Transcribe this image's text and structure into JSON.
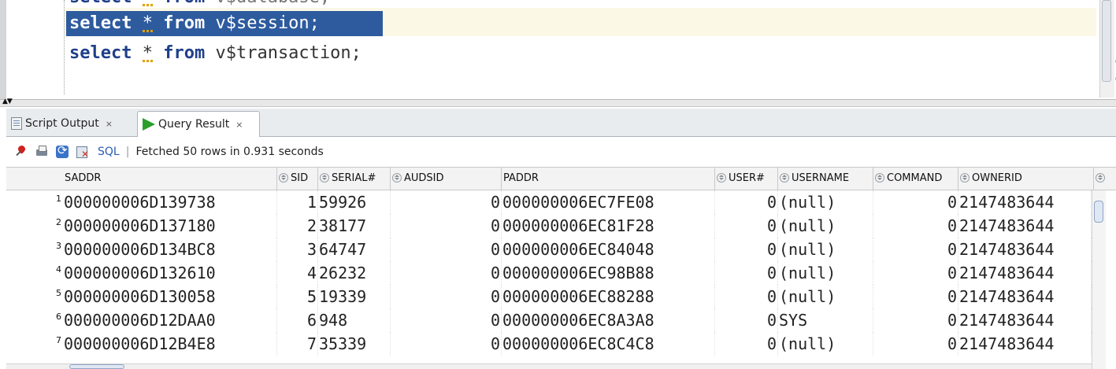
{
  "editor": {
    "lines": [
      {
        "kw1": "select",
        "star": "*",
        "kw2": "from",
        "obj": "v$database;"
      },
      {
        "kw1": "select",
        "star": "*",
        "kw2": "from",
        "obj": "v$session;"
      },
      {
        "kw1": "select",
        "star": "*",
        "kw2": "from",
        "obj": "v$transaction;"
      }
    ]
  },
  "tabs": {
    "script_output": "Script Output",
    "query_result": "Query Result",
    "close": "×"
  },
  "toolbar": {
    "sql_label": "SQL",
    "separator": "|",
    "status": "Fetched 50 rows in 0.931 seconds"
  },
  "grid": {
    "columns": [
      "SADDR",
      "SID",
      "SERIAL#",
      "AUDSID",
      "PADDR",
      "USER#",
      "USERNAME",
      "COMMAND",
      "OWNERID"
    ],
    "rows": [
      {
        "n": "1",
        "saddr": "000000006D139738",
        "sid": "1",
        "serial": "59926",
        "audsid": "0",
        "paddr": "000000006EC7FE08",
        "user": "0",
        "username": "(null)",
        "command": "0",
        "ownerid": "2147483644"
      },
      {
        "n": "2",
        "saddr": "000000006D137180",
        "sid": "2",
        "serial": "38177",
        "audsid": "0",
        "paddr": "000000006EC81F28",
        "user": "0",
        "username": "(null)",
        "command": "0",
        "ownerid": "2147483644"
      },
      {
        "n": "3",
        "saddr": "000000006D134BC8",
        "sid": "3",
        "serial": "64747",
        "audsid": "0",
        "paddr": "000000006EC84048",
        "user": "0",
        "username": "(null)",
        "command": "0",
        "ownerid": "2147483644"
      },
      {
        "n": "4",
        "saddr": "000000006D132610",
        "sid": "4",
        "serial": "26232",
        "audsid": "0",
        "paddr": "000000006EC98B88",
        "user": "0",
        "username": "(null)",
        "command": "0",
        "ownerid": "2147483644"
      },
      {
        "n": "5",
        "saddr": "000000006D130058",
        "sid": "5",
        "serial": "19339",
        "audsid": "0",
        "paddr": "000000006EC88288",
        "user": "0",
        "username": "(null)",
        "command": "0",
        "ownerid": "2147483644"
      },
      {
        "n": "6",
        "saddr": "000000006D12DAA0",
        "sid": "6",
        "serial": "948",
        "audsid": "0",
        "paddr": "000000006EC8A3A8",
        "user": "0",
        "username": "SYS",
        "command": "0",
        "ownerid": "2147483644"
      },
      {
        "n": "7",
        "saddr": "000000006D12B4E8",
        "sid": "7",
        "serial": "35339",
        "audsid": "0",
        "paddr": "000000006EC8C4C8",
        "user": "0",
        "username": "(null)",
        "command": "0",
        "ownerid": "2147483644"
      }
    ]
  }
}
